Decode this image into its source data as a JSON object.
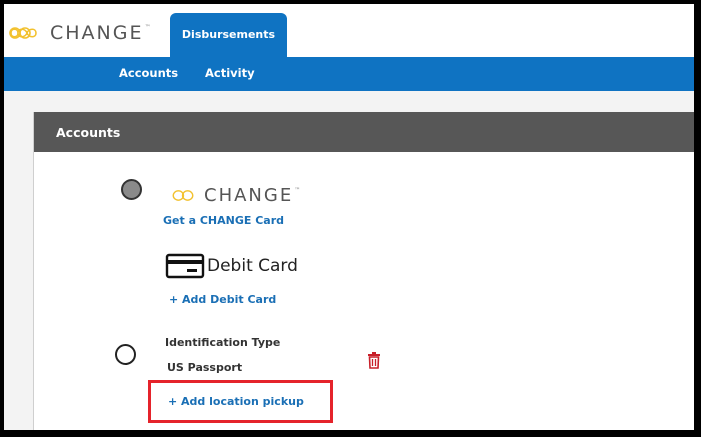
{
  "header": {
    "logo_text": "CHANGE",
    "logo_tm": "™",
    "active_tab": "Disbursements"
  },
  "subnav": {
    "items": [
      "Accounts",
      "Activity"
    ]
  },
  "panel": {
    "title": "Accounts",
    "change_card": {
      "logo_text": "CHANGE",
      "logo_tm": "™",
      "link": "Get a CHANGE Card"
    },
    "debit_card": {
      "label": "Debit Card",
      "link": "+ Add Debit Card"
    },
    "identification": {
      "label": "Identification Type",
      "value": "US Passport"
    },
    "pickup": {
      "link": "+ Add location pickup"
    }
  },
  "colors": {
    "brand_blue": "#0f73c2",
    "logo_gold": "#f2c12e",
    "header_gray": "#575757",
    "link_blue": "#1a6fb5",
    "delete_red": "#c8202a",
    "highlight_red": "#e5232b"
  },
  "icons": {
    "logo": "infinity-icon",
    "debit": "credit-card-icon",
    "delete": "trash-icon"
  }
}
